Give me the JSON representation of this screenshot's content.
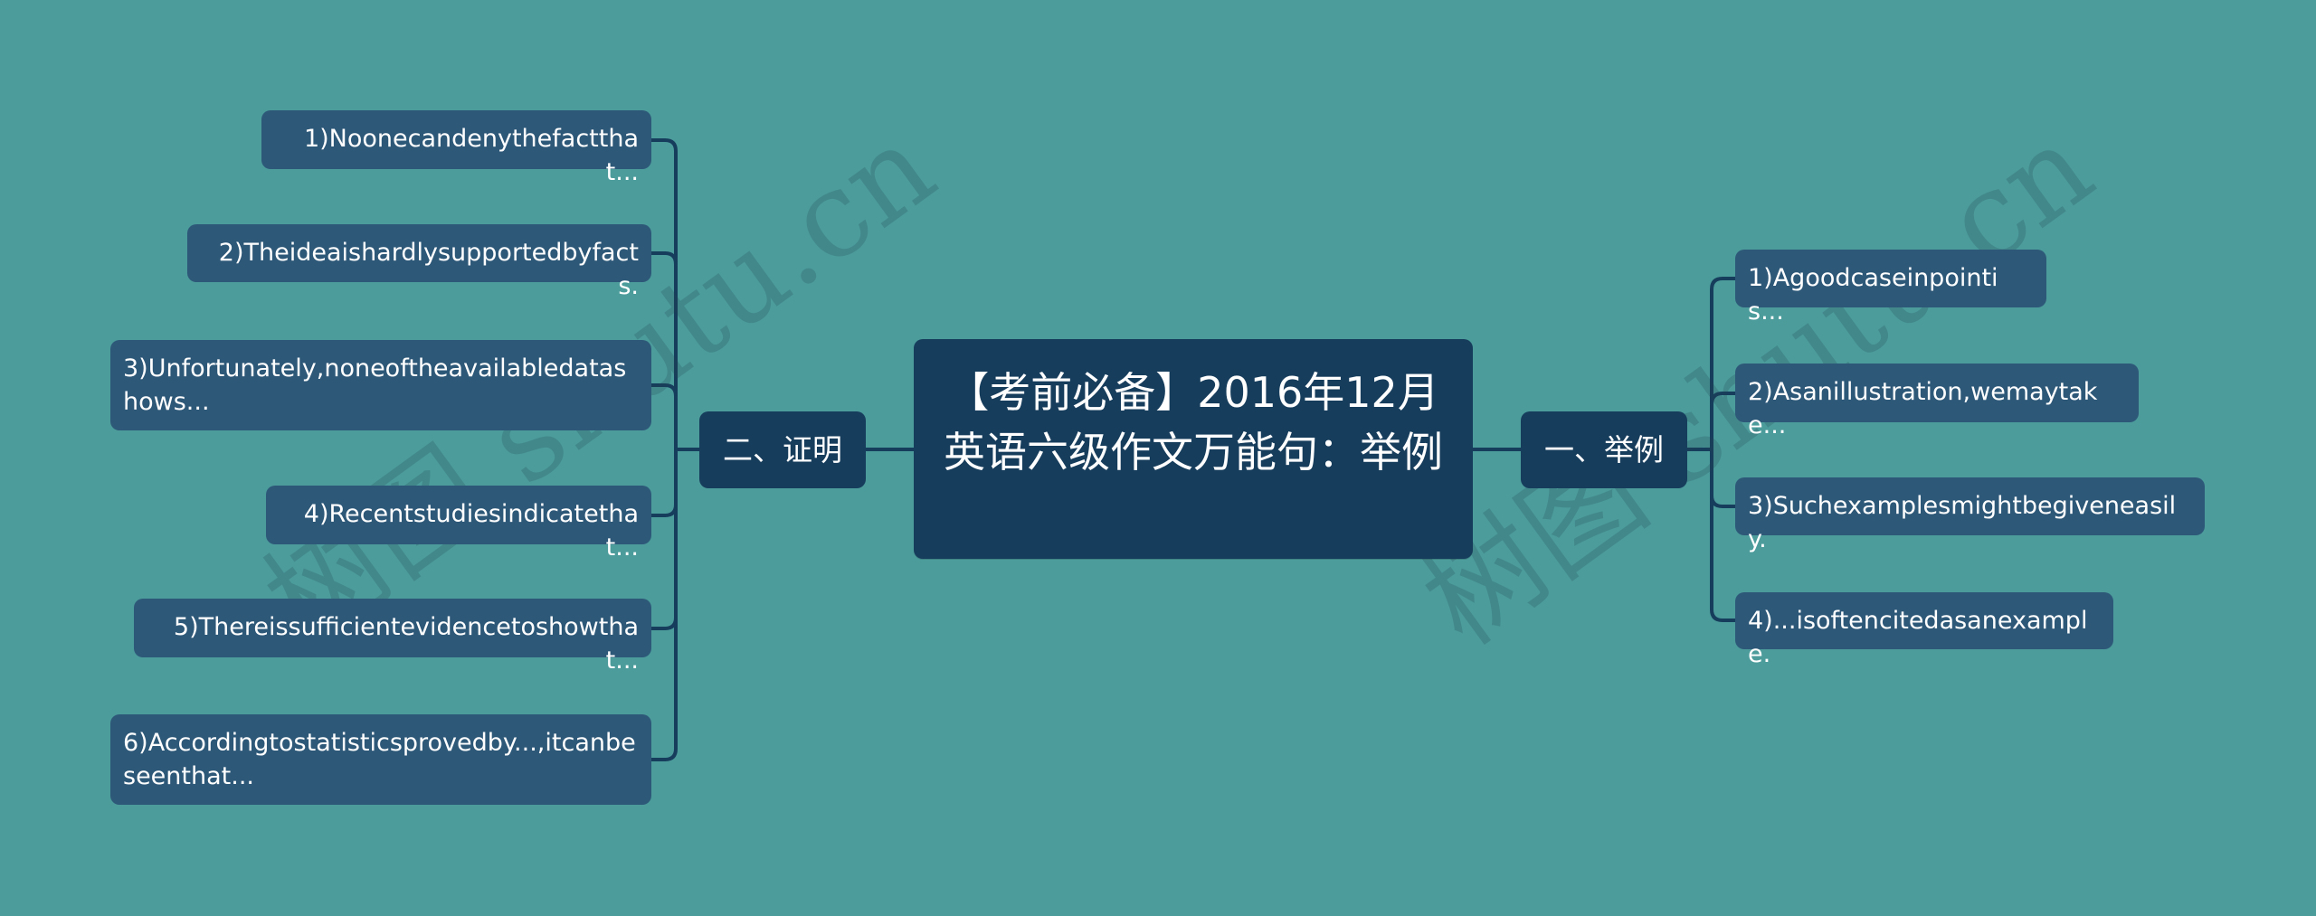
{
  "root": {
    "title": "【考前必备】2016年12月英语六级作文万能句：举例"
  },
  "branches": {
    "left": {
      "label": "二、证明",
      "children": [
        "1)Noonecandenythefactthat...",
        "2)Theideaishardlysupportedbyfacts.",
        "3)Unfortunately,noneoftheavailabledatashows...",
        "4)Recentstudiesindicatethat...",
        "5)Thereissufficientevidencetoshowthat...",
        "6)Accordingtostatisticsprovedby...,itcanbeseenthat..."
      ]
    },
    "right": {
      "label": "一、举例",
      "children": [
        "1)Agoodcaseinpointis...",
        "2)Asanillustration,wemaytake...",
        "3)Suchexamplesmightbegiveneasily.",
        "4)...isoftencitedasanexample."
      ]
    }
  },
  "watermark": "树图 shutu.cn",
  "colors": {
    "background": "#4c9c9c",
    "root_fill": "#173d5c",
    "branch_fill": "#173d5c",
    "leaf_fill": "#2e5878",
    "connector": "#173d5c",
    "text": "#ffffff"
  }
}
